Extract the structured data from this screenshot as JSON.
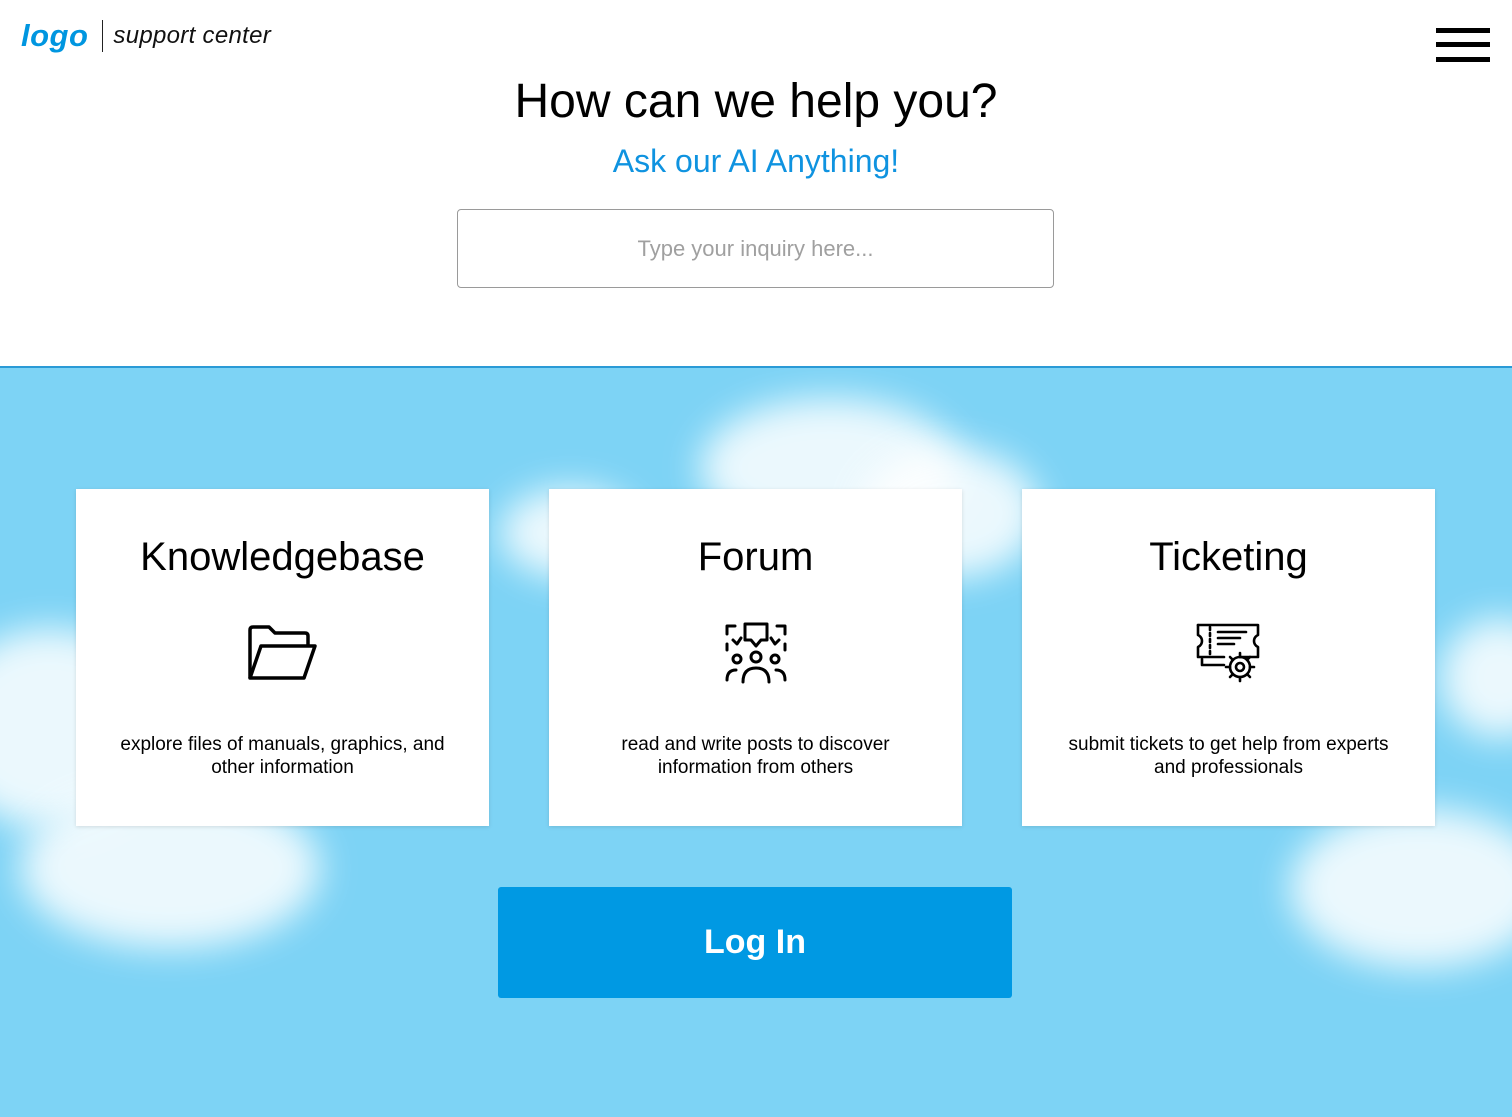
{
  "header": {
    "logo": "logo",
    "subtitle": "support center",
    "menu_icon": "hamburger-menu-icon"
  },
  "hero": {
    "title": "How can we help you?",
    "subtitle": "Ask our AI Anything!",
    "search_placeholder": "Type your inquiry here..."
  },
  "cards": [
    {
      "title": "Knowledgebase",
      "icon": "folder-open-icon",
      "description": "explore files of manuals, graphics, and other information"
    },
    {
      "title": "Forum",
      "icon": "community-chat-icon",
      "description": "read and write posts to discover information from others"
    },
    {
      "title": "Ticketing",
      "icon": "ticket-gear-icon",
      "description": "submit tickets to get help from experts and professionals"
    }
  ],
  "login": {
    "label": "Log In"
  },
  "colors": {
    "accent": "#0099e3",
    "sky": "#7dd3f5",
    "brand": "#0096e0"
  }
}
